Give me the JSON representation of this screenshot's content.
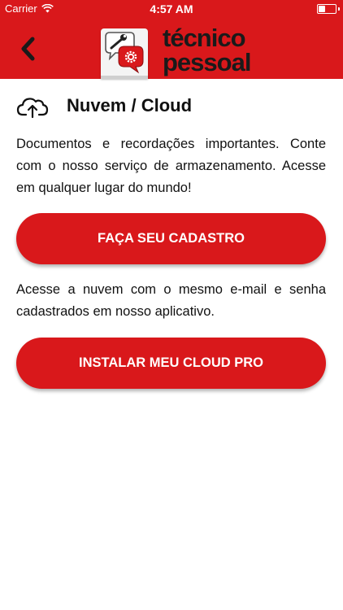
{
  "status_bar": {
    "carrier": "Carrier",
    "time": "4:57 AM",
    "battery_level": 0.45
  },
  "header": {
    "logo_line1": "técnico",
    "logo_line2": "pessoal",
    "back_icon": "chevron-left-icon",
    "background_color": "#d9181b"
  },
  "section": {
    "icon": "cloud-upload-icon",
    "title": "Nuvem / Cloud"
  },
  "content": {
    "paragraph1": "Documentos e recordações importantes. Conte com o nosso serviço de armazenamento. Acesse em qualquer lugar do mundo!",
    "signup_button": "FAÇA SEU CADASTRO",
    "paragraph2": "Acesse a nuvem com o mesmo e-mail e senha cadastrados em nosso aplicativo.",
    "install_button": "INSTALAR MEU CLOUD PRO"
  },
  "colors": {
    "accent": "#d9181b",
    "text": "#111111",
    "background": "#ffffff"
  }
}
